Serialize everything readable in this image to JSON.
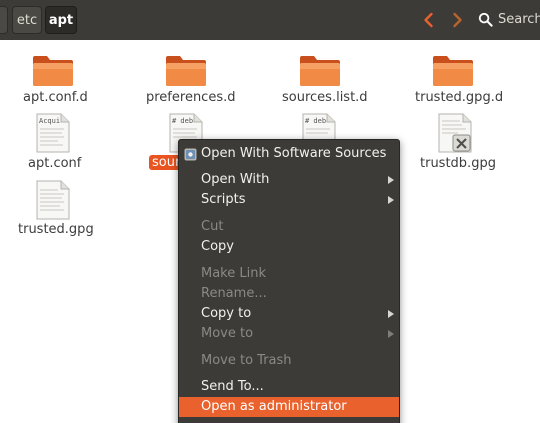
{
  "header": {
    "breadcrumbs": [
      "",
      "etc",
      "apt"
    ],
    "search_label": "Search",
    "back_icon": "chevron-left-icon",
    "forward_icon": "chevron-right-icon",
    "search_icon": "magnifier-icon",
    "accent_color": "#e95420",
    "bar_color": "#3c3b37"
  },
  "files": [
    {
      "name": "apt.conf.d",
      "type": "folder"
    },
    {
      "name": "preferences.d",
      "type": "folder"
    },
    {
      "name": "sources.list.d",
      "type": "folder"
    },
    {
      "name": "trusted.gpg.d",
      "type": "folder"
    },
    {
      "name": "apt.conf",
      "type": "text",
      "preview": "Acqui"
    },
    {
      "name": "sour",
      "type": "text",
      "preview": "# deb",
      "selected": true
    },
    {
      "name": "",
      "type": "text",
      "preview": "# deb"
    },
    {
      "name": "trustdb.gpg",
      "type": "binary"
    },
    {
      "name": "trusted.gpg",
      "type": "text"
    }
  ],
  "context_menu": {
    "items": [
      {
        "label": "Open With Software Sources",
        "state": "normal",
        "icon": "software-sources-icon"
      },
      {
        "label": "Open With",
        "state": "normal",
        "submenu": true
      },
      {
        "label": "Scripts",
        "state": "normal",
        "submenu": true
      },
      {
        "label": "Cut",
        "state": "disabled"
      },
      {
        "label": "Copy",
        "state": "normal"
      },
      {
        "label": "Make Link",
        "state": "disabled"
      },
      {
        "label": "Rename...",
        "state": "disabled"
      },
      {
        "label": "Copy to",
        "state": "normal",
        "submenu": true
      },
      {
        "label": "Move to",
        "state": "disabled",
        "submenu": true
      },
      {
        "label": "Move to Trash",
        "state": "disabled"
      },
      {
        "label": "Send To...",
        "state": "normal"
      },
      {
        "label": "Open as administrator",
        "state": "highlighted"
      }
    ]
  }
}
